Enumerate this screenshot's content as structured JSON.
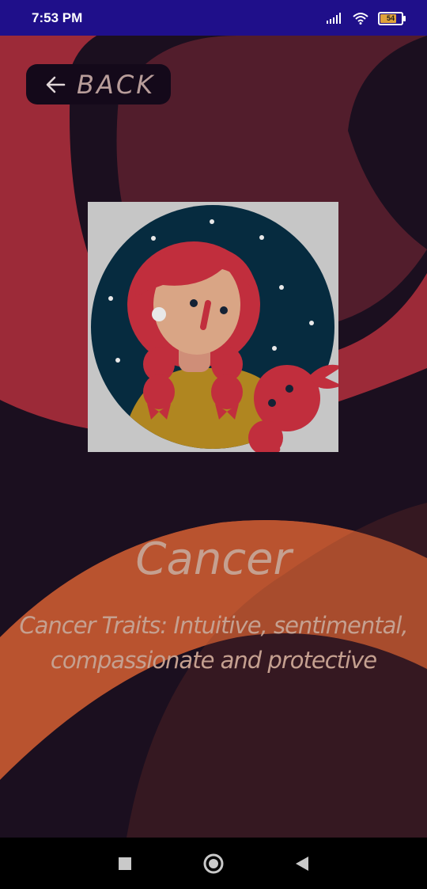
{
  "status_bar": {
    "time": "7:53 PM",
    "battery_level": "54",
    "icons": [
      "signal-icon",
      "wifi-icon",
      "battery-icon"
    ],
    "color": "#1f0f8a"
  },
  "header": {
    "back_label": "BACK"
  },
  "sign": {
    "name": "Cancer",
    "traits": "Cancer Traits: Intuitive, sentimental, compassionate and protective"
  },
  "colors": {
    "background": "#1b0f1f",
    "text": "#c5a090",
    "accent_red": "#b22d3c",
    "accent_orange": "#b9532f"
  },
  "nav_bar": {
    "buttons": [
      "recents-square-icon",
      "home-circle-icon",
      "back-triangle-icon"
    ]
  }
}
